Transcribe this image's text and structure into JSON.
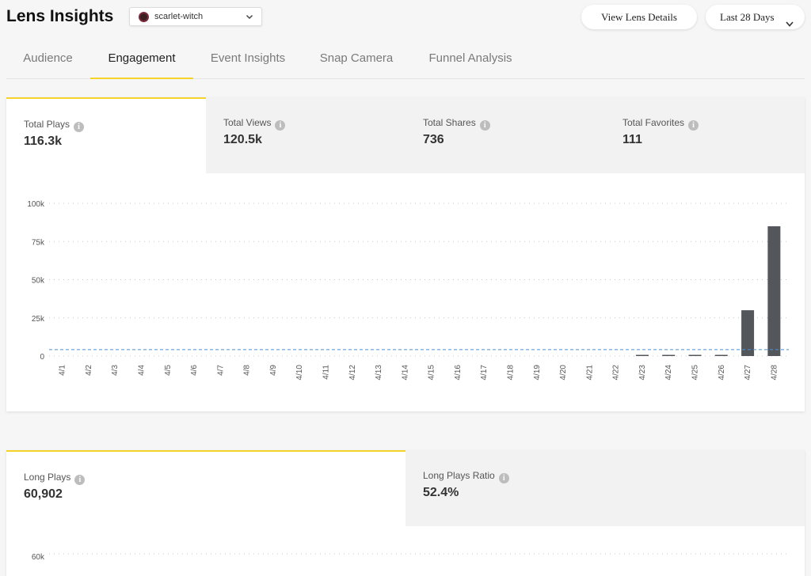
{
  "header": {
    "title": "Lens Insights",
    "lens_select": {
      "value": "scarlet-witch"
    },
    "view_details_label": "View Lens Details",
    "date_range_label": "Last 28 Days"
  },
  "tabs": [
    {
      "label": "Audience",
      "active": false
    },
    {
      "label": "Engagement",
      "active": true
    },
    {
      "label": "Event Insights",
      "active": false
    },
    {
      "label": "Snap Camera",
      "active": false
    },
    {
      "label": "Funnel Analysis",
      "active": false
    }
  ],
  "engagement_metrics": [
    {
      "label": "Total Plays",
      "value": "116.3k",
      "active": true
    },
    {
      "label": "Total Views",
      "value": "120.5k",
      "active": false
    },
    {
      "label": "Total Shares",
      "value": "736",
      "active": false
    },
    {
      "label": "Total Favorites",
      "value": "111",
      "active": false
    }
  ],
  "chart_data": {
    "type": "bar",
    "categories": [
      "4/1",
      "4/2",
      "4/3",
      "4/4",
      "4/5",
      "4/6",
      "4/7",
      "4/8",
      "4/9",
      "4/10",
      "4/11",
      "4/12",
      "4/13",
      "4/14",
      "4/15",
      "4/16",
      "4/17",
      "4/18",
      "4/19",
      "4/20",
      "4/21",
      "4/22",
      "4/23",
      "4/24",
      "4/25",
      "4/26",
      "4/27",
      "4/28"
    ],
    "values": [
      0,
      0,
      0,
      0,
      0,
      0,
      0,
      0,
      0,
      0,
      0,
      0,
      0,
      0,
      0,
      0,
      0,
      0,
      0,
      0,
      0,
      0,
      150,
      700,
      500,
      600,
      30000,
      85000
    ],
    "ylim": [
      0,
      100000
    ],
    "ytick_labels": [
      "0",
      "25k",
      "50k",
      "75k",
      "100k"
    ],
    "reference_line": 4200,
    "grid": true,
    "colors": {
      "bar": "#53565a",
      "reference_line": "#4a90d9",
      "grid": "#c9c9c9"
    }
  },
  "long_play_metrics": [
    {
      "label": "Long Plays",
      "value": "60,902",
      "active": true
    },
    {
      "label": "Long Plays Ratio",
      "value": "52.4%",
      "active": false
    }
  ],
  "long_plays_chart": {
    "top_tick_label": "60k"
  },
  "colors": {
    "accent": "#f5d32a",
    "page_bg": "#f6f6f6"
  }
}
